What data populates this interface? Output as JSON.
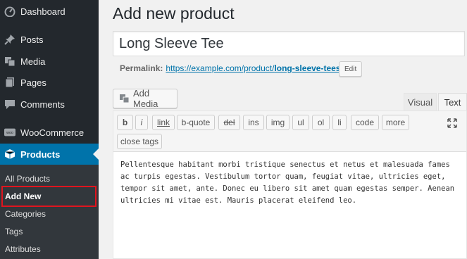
{
  "sidebar": {
    "menu": [
      {
        "label": "Dashboard",
        "icon": "dashboard-icon"
      },
      {
        "label": "Posts",
        "icon": "pin-icon"
      },
      {
        "label": "Media",
        "icon": "media-icon"
      },
      {
        "label": "Pages",
        "icon": "pages-icon"
      },
      {
        "label": "Comments",
        "icon": "comments-icon"
      },
      {
        "label": "WooCommerce",
        "icon": "woocommerce-icon"
      },
      {
        "label": "Products",
        "icon": "products-icon"
      }
    ],
    "submenu": [
      {
        "label": "All Products"
      },
      {
        "label": "Add New"
      },
      {
        "label": "Categories"
      },
      {
        "label": "Tags"
      },
      {
        "label": "Attributes"
      }
    ]
  },
  "page": {
    "title": "Add new product",
    "title_input_value": "Long Sleeve Tee",
    "permalink_label": "Permalink:",
    "permalink_base": "https://example.com/product/",
    "permalink_slug": "long-sleeve-tees",
    "permalink_trail": "/",
    "edit_label": "Edit"
  },
  "editor": {
    "add_media_label": "Add Media",
    "tabs": {
      "visual": "Visual",
      "text": "Text"
    },
    "quicktags": [
      "b",
      "i",
      "link",
      "b-quote",
      "del",
      "ins",
      "img",
      "ul",
      "ol",
      "li",
      "code",
      "more",
      "close tags"
    ],
    "content": "Pellentesque habitant morbi tristique senectus et netus et malesuada fames ac turpis egestas. Vestibulum tortor quam, feugiat vitae, ultricies eget, tempor sit amet, ante. Donec eu libero sit amet quam egestas semper. Aenean ultricies mi vitae est. Mauris placerat eleifend leo."
  },
  "colors": {
    "sidebar_bg": "#23282d",
    "active_menu": "#0073aa",
    "highlight": "#e0141e",
    "link": "#0073aa"
  }
}
